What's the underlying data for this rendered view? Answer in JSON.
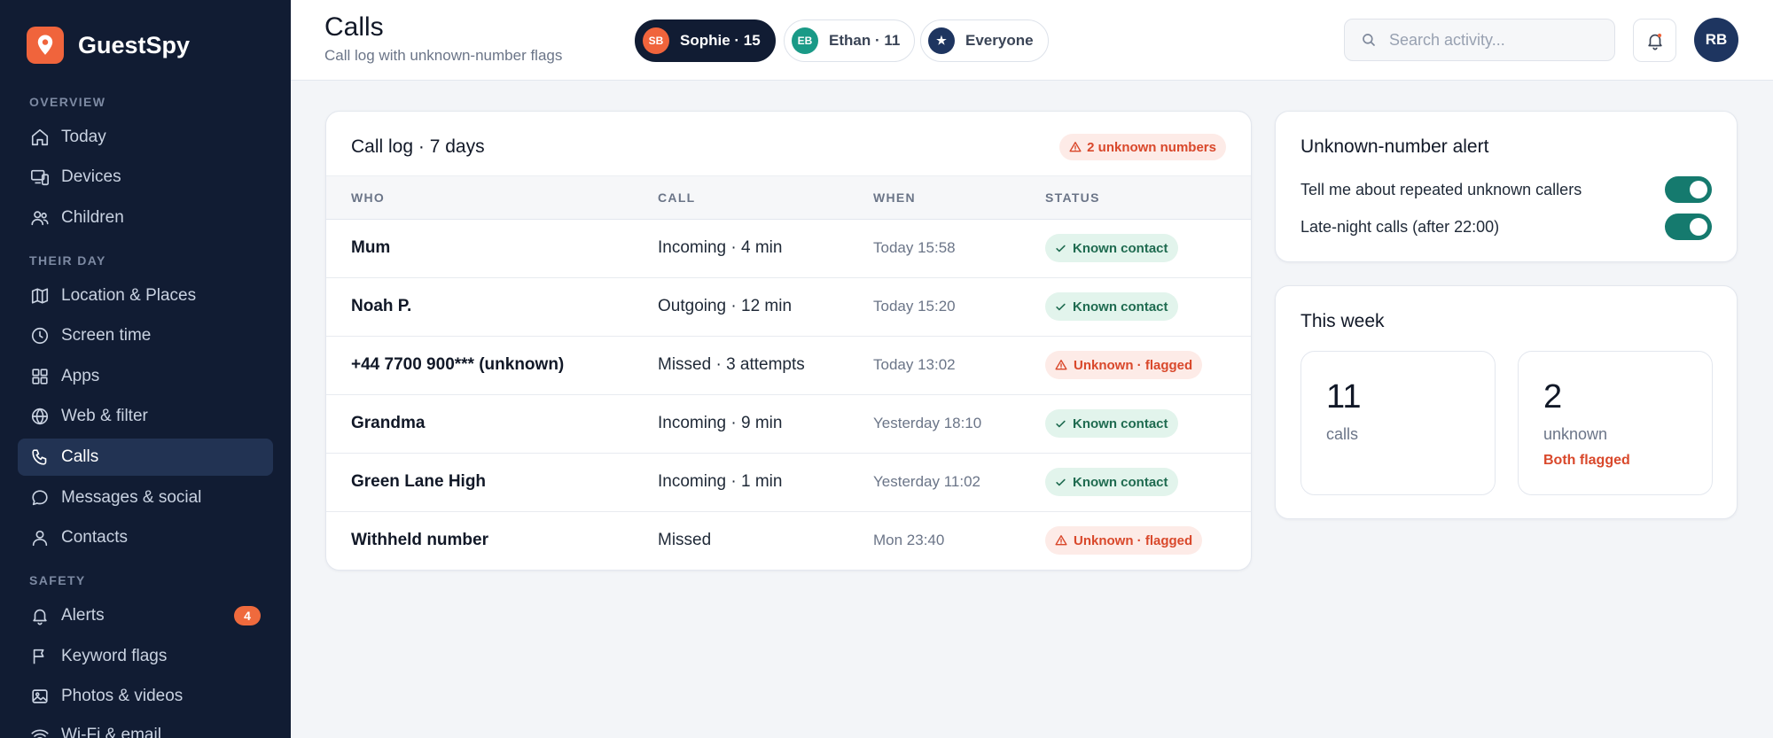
{
  "app": {
    "name": "GuestSpy"
  },
  "sidebar": {
    "sections": {
      "overview": "OVERVIEW",
      "their_day": "THEIR DAY",
      "safety": "SAFETY"
    },
    "items": {
      "today": "Today",
      "devices": "Devices",
      "children": "Children",
      "location": "Location & Places",
      "screen_time": "Screen time",
      "apps": "Apps",
      "web_filter": "Web & filter",
      "calls": "Calls",
      "messages": "Messages & social",
      "contacts": "Contacts",
      "alerts": "Alerts",
      "alerts_badge": "4",
      "keyword_flags": "Keyword flags",
      "photos": "Photos & videos",
      "wifi": "Wi-Fi & email"
    },
    "active": "calls"
  },
  "header": {
    "title": "Calls",
    "subtitle": "Call log with unknown-number flags",
    "children": [
      {
        "initials": "SB",
        "label": "Sophie · 15",
        "active": true,
        "color": "#f0643c"
      },
      {
        "initials": "EB",
        "label": "Ethan · 11",
        "active": false,
        "color": "#1a9a87"
      },
      {
        "initials": "★",
        "label": "Everyone",
        "active": false,
        "color": "#1e3560"
      }
    ],
    "search_placeholder": "Search activity...",
    "user_initials": "RB"
  },
  "call_log": {
    "title": "Call log · 7 days",
    "unknown_pill": "2 unknown numbers",
    "columns": {
      "who": "WHO",
      "call": "CALL",
      "when": "WHEN",
      "status": "STATUS"
    },
    "rows": [
      {
        "who": "Mum",
        "call": "Incoming · 4 min",
        "when": "Today 15:58",
        "status": "Known contact",
        "kind": "known"
      },
      {
        "who": "Noah P.",
        "call": "Outgoing · 12 min",
        "when": "Today 15:20",
        "status": "Known contact",
        "kind": "known"
      },
      {
        "who": "+44 7700 900*** (unknown)",
        "call": "Missed · 3 attempts",
        "when": "Today 13:02",
        "status": "Unknown · flagged",
        "kind": "unknown"
      },
      {
        "who": "Grandma",
        "call": "Incoming · 9 min",
        "when": "Yesterday 18:10",
        "status": "Known contact",
        "kind": "known"
      },
      {
        "who": "Green Lane High",
        "call": "Incoming · 1 min",
        "when": "Yesterday 11:02",
        "status": "Known contact",
        "kind": "known"
      },
      {
        "who": "Withheld number",
        "call": "Missed",
        "when": "Mon 23:40",
        "status": "Unknown · flagged",
        "kind": "unknown"
      }
    ]
  },
  "alert_card": {
    "title": "Unknown-number alert",
    "toggles": [
      {
        "label": "Tell me about repeated unknown callers",
        "on": true
      },
      {
        "label": "Late-night calls (after 22:00)",
        "on": true
      }
    ]
  },
  "week_card": {
    "title": "This week",
    "stats": [
      {
        "value": "11",
        "label": "calls",
        "note": ""
      },
      {
        "value": "2",
        "label": "unknown",
        "note": "Both flagged"
      }
    ]
  },
  "colors": {
    "sidebar_bg": "#111c33",
    "accent": "#f0643c",
    "toggle_on": "#157a6e",
    "known": "#1f6b50",
    "unknown": "#d9482b"
  }
}
